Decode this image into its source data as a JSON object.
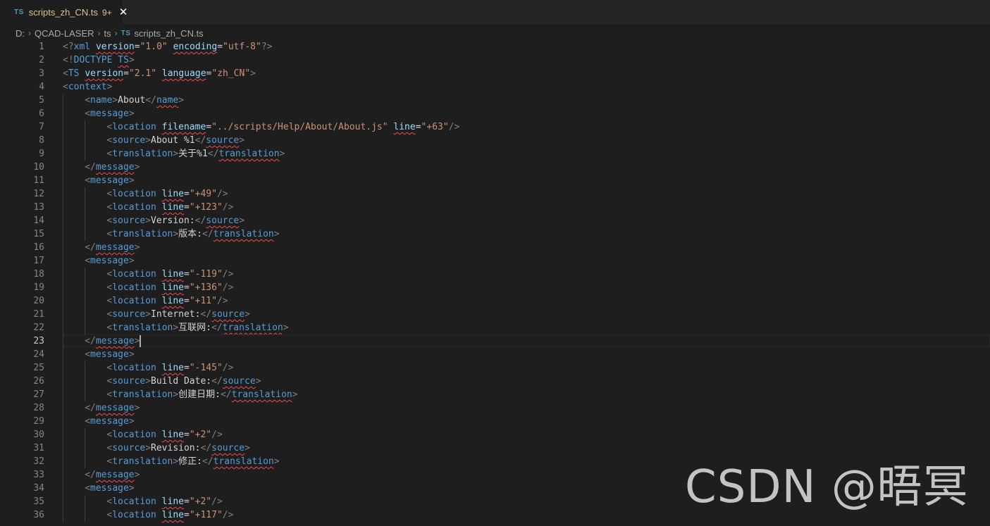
{
  "tab": {
    "icon": "TS",
    "filename": "scripts_zh_CN.ts",
    "badge": "9+",
    "close": "✕"
  },
  "breadcrumb": [
    "D:",
    "QCAD-LASER",
    "ts",
    "scripts_zh_CN.ts"
  ],
  "watermark": "CSDN @晤冥",
  "colors": {
    "background": "#1e1e1e",
    "tag": "#569cd6",
    "attribute": "#9cdcfe",
    "string": "#ce9178",
    "bracket": "#808080",
    "text": "#d4d4d4",
    "modified": "#e2c08d"
  },
  "active_line": 23,
  "lines": [
    {
      "n": "1",
      "indent": 0,
      "tokens": [
        [
          "b",
          "<?"
        ],
        [
          "t",
          "xml"
        ],
        [
          "x",
          " "
        ],
        [
          "a",
          "version",
          "sq"
        ],
        [
          "x",
          "="
        ],
        [
          "s",
          "\"1.0\""
        ],
        [
          "x",
          " "
        ],
        [
          "a",
          "encoding",
          "sq"
        ],
        [
          "x",
          "="
        ],
        [
          "s",
          "\"utf-8\""
        ],
        [
          "b",
          "?>"
        ]
      ]
    },
    {
      "n": "2",
      "indent": 0,
      "tokens": [
        [
          "b",
          "<!"
        ],
        [
          "t",
          "DOCTYPE"
        ],
        [
          "x",
          " "
        ],
        [
          "t",
          "TS",
          "sq"
        ],
        [
          "b",
          ">"
        ]
      ]
    },
    {
      "n": "3",
      "indent": 0,
      "tokens": [
        [
          "b",
          "<"
        ],
        [
          "t",
          "TS"
        ],
        [
          "x",
          " "
        ],
        [
          "a",
          "version",
          "sq"
        ],
        [
          "x",
          "="
        ],
        [
          "s",
          "\"2.1\""
        ],
        [
          "x",
          " "
        ],
        [
          "a",
          "language",
          "sq"
        ],
        [
          "x",
          "="
        ],
        [
          "s",
          "\"zh_CN\""
        ],
        [
          "b",
          ">"
        ]
      ]
    },
    {
      "n": "4",
      "indent": 0,
      "tokens": [
        [
          "b",
          "<"
        ],
        [
          "t",
          "context"
        ],
        [
          "b",
          ">"
        ]
      ]
    },
    {
      "n": "5",
      "indent": 1,
      "tokens": [
        [
          "b",
          "<"
        ],
        [
          "t",
          "name"
        ],
        [
          "b",
          ">"
        ],
        [
          "x",
          "About"
        ],
        [
          "b",
          "</"
        ],
        [
          "t",
          "name",
          "sq"
        ],
        [
          "b",
          ">"
        ]
      ]
    },
    {
      "n": "6",
      "indent": 1,
      "tokens": [
        [
          "b",
          "<"
        ],
        [
          "t",
          "message"
        ],
        [
          "b",
          ">"
        ]
      ]
    },
    {
      "n": "7",
      "indent": 2,
      "tokens": [
        [
          "b",
          "<"
        ],
        [
          "t",
          "location"
        ],
        [
          "x",
          " "
        ],
        [
          "a",
          "filename",
          "sq"
        ],
        [
          "x",
          "="
        ],
        [
          "s",
          "\"../scripts/Help/About/About.js\""
        ],
        [
          "x",
          " "
        ],
        [
          "a",
          "line",
          "sq"
        ],
        [
          "x",
          "="
        ],
        [
          "s",
          "\"+63\""
        ],
        [
          "b",
          "/>"
        ]
      ]
    },
    {
      "n": "8",
      "indent": 2,
      "tokens": [
        [
          "b",
          "<"
        ],
        [
          "t",
          "source"
        ],
        [
          "b",
          ">"
        ],
        [
          "x",
          "About %1"
        ],
        [
          "b",
          "</"
        ],
        [
          "t",
          "source",
          "sq"
        ],
        [
          "b",
          ">"
        ]
      ]
    },
    {
      "n": "9",
      "indent": 2,
      "tokens": [
        [
          "b",
          "<"
        ],
        [
          "t",
          "translation"
        ],
        [
          "b",
          ">"
        ],
        [
          "x",
          "关于%1"
        ],
        [
          "b",
          "</"
        ],
        [
          "t",
          "translation",
          "sq"
        ],
        [
          "b",
          ">"
        ]
      ]
    },
    {
      "n": "10",
      "indent": 1,
      "tokens": [
        [
          "b",
          "</"
        ],
        [
          "t",
          "message",
          "sq"
        ],
        [
          "b",
          ">"
        ]
      ]
    },
    {
      "n": "11",
      "indent": 1,
      "tokens": [
        [
          "b",
          "<"
        ],
        [
          "t",
          "message"
        ],
        [
          "b",
          ">"
        ]
      ]
    },
    {
      "n": "12",
      "indent": 2,
      "tokens": [
        [
          "b",
          "<"
        ],
        [
          "t",
          "location"
        ],
        [
          "x",
          " "
        ],
        [
          "a",
          "line",
          "sq"
        ],
        [
          "x",
          "="
        ],
        [
          "s",
          "\"+49\""
        ],
        [
          "b",
          "/>"
        ]
      ]
    },
    {
      "n": "13",
      "indent": 2,
      "tokens": [
        [
          "b",
          "<"
        ],
        [
          "t",
          "location"
        ],
        [
          "x",
          " "
        ],
        [
          "a",
          "line",
          "sq"
        ],
        [
          "x",
          "="
        ],
        [
          "s",
          "\"+123\""
        ],
        [
          "b",
          "/>"
        ]
      ]
    },
    {
      "n": "14",
      "indent": 2,
      "tokens": [
        [
          "b",
          "<"
        ],
        [
          "t",
          "source"
        ],
        [
          "b",
          ">"
        ],
        [
          "x",
          "Version:"
        ],
        [
          "b",
          "</"
        ],
        [
          "t",
          "source",
          "sq"
        ],
        [
          "b",
          ">"
        ]
      ]
    },
    {
      "n": "15",
      "indent": 2,
      "tokens": [
        [
          "b",
          "<"
        ],
        [
          "t",
          "translation"
        ],
        [
          "b",
          ">"
        ],
        [
          "x",
          "版本:"
        ],
        [
          "b",
          "</"
        ],
        [
          "t",
          "translation",
          "sq"
        ],
        [
          "b",
          ">"
        ]
      ]
    },
    {
      "n": "16",
      "indent": 1,
      "tokens": [
        [
          "b",
          "</"
        ],
        [
          "t",
          "message",
          "sq"
        ],
        [
          "b",
          ">"
        ]
      ]
    },
    {
      "n": "17",
      "indent": 1,
      "tokens": [
        [
          "b",
          "<"
        ],
        [
          "t",
          "message"
        ],
        [
          "b",
          ">"
        ]
      ]
    },
    {
      "n": "18",
      "indent": 2,
      "tokens": [
        [
          "b",
          "<"
        ],
        [
          "t",
          "location"
        ],
        [
          "x",
          " "
        ],
        [
          "a",
          "line",
          "sq"
        ],
        [
          "x",
          "="
        ],
        [
          "s",
          "\"-119\""
        ],
        [
          "b",
          "/>"
        ]
      ]
    },
    {
      "n": "19",
      "indent": 2,
      "tokens": [
        [
          "b",
          "<"
        ],
        [
          "t",
          "location"
        ],
        [
          "x",
          " "
        ],
        [
          "a",
          "line",
          "sq"
        ],
        [
          "x",
          "="
        ],
        [
          "s",
          "\"+136\""
        ],
        [
          "b",
          "/>"
        ]
      ]
    },
    {
      "n": "20",
      "indent": 2,
      "tokens": [
        [
          "b",
          "<"
        ],
        [
          "t",
          "location"
        ],
        [
          "x",
          " "
        ],
        [
          "a",
          "line",
          "sq"
        ],
        [
          "x",
          "="
        ],
        [
          "s",
          "\"+11\""
        ],
        [
          "b",
          "/>"
        ]
      ]
    },
    {
      "n": "21",
      "indent": 2,
      "tokens": [
        [
          "b",
          "<"
        ],
        [
          "t",
          "source"
        ],
        [
          "b",
          ">"
        ],
        [
          "x",
          "Internet:"
        ],
        [
          "b",
          "</"
        ],
        [
          "t",
          "source",
          "sq"
        ],
        [
          "b",
          ">"
        ]
      ]
    },
    {
      "n": "22",
      "indent": 2,
      "tokens": [
        [
          "b",
          "<"
        ],
        [
          "t",
          "translation"
        ],
        [
          "b",
          ">"
        ],
        [
          "x",
          "互联网:"
        ],
        [
          "b",
          "</"
        ],
        [
          "t",
          "translation",
          "sq"
        ],
        [
          "b",
          ">"
        ]
      ]
    },
    {
      "n": "23",
      "indent": 1,
      "tokens": [
        [
          "b",
          "</"
        ],
        [
          "t",
          "message",
          "sq"
        ],
        [
          "b",
          ">"
        ]
      ]
    },
    {
      "n": "24",
      "indent": 1,
      "tokens": [
        [
          "b",
          "<"
        ],
        [
          "t",
          "message"
        ],
        [
          "b",
          ">"
        ]
      ]
    },
    {
      "n": "25",
      "indent": 2,
      "tokens": [
        [
          "b",
          "<"
        ],
        [
          "t",
          "location"
        ],
        [
          "x",
          " "
        ],
        [
          "a",
          "line",
          "sq"
        ],
        [
          "x",
          "="
        ],
        [
          "s",
          "\"-145\""
        ],
        [
          "b",
          "/>"
        ]
      ]
    },
    {
      "n": "26",
      "indent": 2,
      "tokens": [
        [
          "b",
          "<"
        ],
        [
          "t",
          "source"
        ],
        [
          "b",
          ">"
        ],
        [
          "x",
          "Build Date:"
        ],
        [
          "b",
          "</"
        ],
        [
          "t",
          "source",
          "sq"
        ],
        [
          "b",
          ">"
        ]
      ]
    },
    {
      "n": "27",
      "indent": 2,
      "tokens": [
        [
          "b",
          "<"
        ],
        [
          "t",
          "translation"
        ],
        [
          "b",
          ">"
        ],
        [
          "x",
          "创建日期:"
        ],
        [
          "b",
          "</"
        ],
        [
          "t",
          "translation",
          "sq"
        ],
        [
          "b",
          ">"
        ]
      ]
    },
    {
      "n": "28",
      "indent": 1,
      "tokens": [
        [
          "b",
          "</"
        ],
        [
          "t",
          "message",
          "sq"
        ],
        [
          "b",
          ">"
        ]
      ]
    },
    {
      "n": "29",
      "indent": 1,
      "tokens": [
        [
          "b",
          "<"
        ],
        [
          "t",
          "message"
        ],
        [
          "b",
          ">"
        ]
      ]
    },
    {
      "n": "30",
      "indent": 2,
      "tokens": [
        [
          "b",
          "<"
        ],
        [
          "t",
          "location"
        ],
        [
          "x",
          " "
        ],
        [
          "a",
          "line",
          "sq"
        ],
        [
          "x",
          "="
        ],
        [
          "s",
          "\"+2\""
        ],
        [
          "b",
          "/>"
        ]
      ]
    },
    {
      "n": "31",
      "indent": 2,
      "tokens": [
        [
          "b",
          "<"
        ],
        [
          "t",
          "source"
        ],
        [
          "b",
          ">"
        ],
        [
          "x",
          "Revision:"
        ],
        [
          "b",
          "</"
        ],
        [
          "t",
          "source",
          "sq"
        ],
        [
          "b",
          ">"
        ]
      ]
    },
    {
      "n": "32",
      "indent": 2,
      "tokens": [
        [
          "b",
          "<"
        ],
        [
          "t",
          "translation"
        ],
        [
          "b",
          ">"
        ],
        [
          "x",
          "修正:"
        ],
        [
          "b",
          "</"
        ],
        [
          "t",
          "translation",
          "sq"
        ],
        [
          "b",
          ">"
        ]
      ]
    },
    {
      "n": "33",
      "indent": 1,
      "tokens": [
        [
          "b",
          "</"
        ],
        [
          "t",
          "message",
          "sq"
        ],
        [
          "b",
          ">"
        ]
      ]
    },
    {
      "n": "34",
      "indent": 1,
      "tokens": [
        [
          "b",
          "<"
        ],
        [
          "t",
          "message"
        ],
        [
          "b",
          ">"
        ]
      ]
    },
    {
      "n": "35",
      "indent": 2,
      "tokens": [
        [
          "b",
          "<"
        ],
        [
          "t",
          "location"
        ],
        [
          "x",
          " "
        ],
        [
          "a",
          "line",
          "sq"
        ],
        [
          "x",
          "="
        ],
        [
          "s",
          "\"+2\""
        ],
        [
          "b",
          "/>"
        ]
      ]
    },
    {
      "n": "36",
      "indent": 2,
      "tokens": [
        [
          "b",
          "<"
        ],
        [
          "t",
          "location"
        ],
        [
          "x",
          " "
        ],
        [
          "a",
          "line",
          "sq"
        ],
        [
          "x",
          "="
        ],
        [
          "s",
          "\"+117\""
        ],
        [
          "b",
          "/>"
        ]
      ]
    }
  ]
}
